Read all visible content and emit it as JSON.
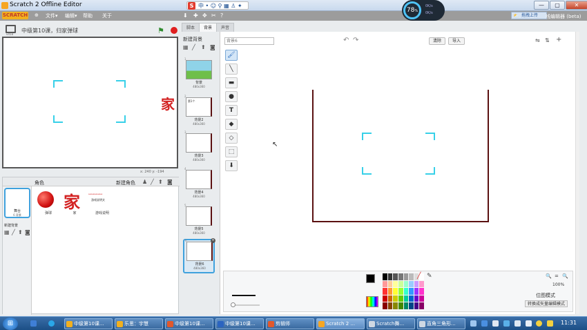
{
  "window": {
    "title": "Scratch 2 Offline Editor",
    "minimize": "—",
    "maximize": "▢",
    "close": "✕"
  },
  "menu": {
    "logo": "SCRATCH",
    "globe": "⊕",
    "file": "文件▾",
    "edit": "编辑▾",
    "help": "帮助",
    "about": "关于"
  },
  "toolbar_icons": [
    "⬇",
    "✚",
    "✥",
    "✂",
    "?"
  ],
  "ime": {
    "logo": "S",
    "items": "中 • ☺ ⚲ ▦ ♙ ✦ ✎"
  },
  "netmeter": {
    "value": "78",
    "unit": "%",
    "up": "0K/s",
    "down": "0K/s"
  },
  "upload": {
    "label": "拖拽上传",
    "icon": "⛅"
  },
  "beta_title": "线编辑器 (beta)",
  "stage": {
    "mode_label": "v458",
    "title": "中级第10课，归家弹球",
    "char": "家",
    "coords": "x: 240  y: -194"
  },
  "sprites": {
    "header": "角色",
    "new_sprite": "新建角色",
    "stage_thumb_name": "舞台",
    "stage_thumb_count": "6 背景",
    "new_backdrop": "新建背景",
    "items": [
      {
        "name": "弹球"
      },
      {
        "name": "家",
        "glyph": "家"
      },
      {
        "name": "游戏说明",
        "glyph": "ꟷꟷꟷꟷꟷ",
        "sub": "游戏说明文"
      }
    ]
  },
  "tabs": {
    "scripts": "脚本",
    "backdrops": "背景",
    "sounds": "声音"
  },
  "costumes": {
    "new_backdrop": "新建背景",
    "items": [
      {
        "num": "1",
        "name": "背景",
        "size": "480x360",
        "preview": ""
      },
      {
        "num": "2",
        "name": "背景2",
        "size": "480x360",
        "preview": "第1个"
      },
      {
        "num": "3",
        "name": "背景3",
        "size": "480x360",
        "preview": ""
      },
      {
        "num": "4",
        "name": "背景4",
        "size": "480x360",
        "preview": ""
      },
      {
        "num": "5",
        "name": "背景5",
        "size": "480x360",
        "preview": ""
      },
      {
        "num": "6",
        "name": "背景6",
        "size": "480x360",
        "preview": ""
      }
    ],
    "delete": "×"
  },
  "editor": {
    "name_value": "背景6",
    "undo": "↶",
    "redo": "↷",
    "clear": "清除",
    "import": "导入",
    "zoom": "100%",
    "bitmap_mode": "位图模式",
    "convert": "转换成矢量编辑模式",
    "zoom_out": "🔍",
    "zoom_reset": "=",
    "zoom_in": "🔍",
    "tools": [
      "🖌",
      "╲",
      "▬",
      "●",
      "T",
      "◆",
      "◇",
      "⬚",
      "⬇"
    ]
  },
  "palette_colors": [
    "#000000",
    "#333333",
    "#555555",
    "#777777",
    "#999999",
    "#bbbbbb",
    "#dddddd",
    "#ffffff",
    "#ff9999",
    "#ffcc99",
    "#ffff99",
    "#ccff99",
    "#99ffcc",
    "#99ccff",
    "#cc99ff",
    "#ff99cc",
    "#ff3333",
    "#ff9933",
    "#ffff33",
    "#99ff33",
    "#33ffcc",
    "#3399ff",
    "#9933ff",
    "#ff33cc",
    "#cc0000",
    "#cc6600",
    "#cccc00",
    "#66cc00",
    "#00cc99",
    "#0066cc",
    "#6600cc",
    "#cc0099",
    "#880000",
    "#884400",
    "#888800",
    "#448800",
    "#008866",
    "#004488",
    "#440088",
    "#880066"
  ],
  "taskbar": {
    "start": "⊞",
    "items": [
      {
        "label": "中级第10课...",
        "color": "#f2b01e"
      },
      {
        "label": "乐思：宇慧",
        "color": "#f2b01e"
      },
      {
        "label": "中级第10课...",
        "color": "#e2582b"
      },
      {
        "label": "中级第10课...",
        "color": "#2b64c0"
      },
      {
        "label": "剪辑师",
        "color": "#e2582b"
      },
      {
        "label": "Scratch 2 ...",
        "color": "#f6a623"
      },
      {
        "label": "Scratch舞...",
        "color": "#cfd8e3"
      },
      {
        "label": "直角三角形...",
        "color": "#cfd8e3"
      }
    ],
    "clock": "11:31"
  }
}
